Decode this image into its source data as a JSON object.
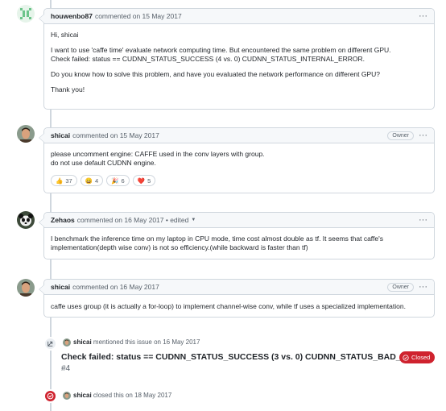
{
  "comments": [
    {
      "author": "houwenbo87",
      "meta": "commented on 15 May 2017",
      "paragraphs": [
        "Hi, shicai",
        "I want to use 'caffe time' evaluate network computing time. But encountered the same problem on different GPU.",
        "Check failed: status == CUDNN_STATUS_SUCCESS (4 vs. 0) CUDNN_STATUS_INTERNAL_ERROR.",
        "Do you know how to solve this problem, and have you evaluated the network performance on different GPU?",
        "Thank you!"
      ]
    },
    {
      "author": "shicai",
      "meta": "commented on 15 May 2017",
      "badge": "Owner",
      "paragraphs": [
        "please uncomment engine: CAFFE used in the conv layers with group.",
        "do not use default CUDNN engine."
      ],
      "reactions": [
        {
          "emoji": "👍",
          "count": "37"
        },
        {
          "emoji": "😄",
          "count": "4"
        },
        {
          "emoji": "🎉",
          "count": "6"
        },
        {
          "emoji": "❤️",
          "count": "5"
        }
      ]
    },
    {
      "author": "Zehaos",
      "meta": "commented on 16 May 2017 • edited",
      "paragraphs": [
        "I benchmark the inference time on my laptop in CPU mode, time cost almost double as tf. It seems that caffe's",
        "implementation(depth wise conv) is not so efficiency.(while backward is faster than tf)"
      ]
    },
    {
      "author": "shicai",
      "meta": "commented on 16 May 2017",
      "badge": "Owner",
      "paragraphs": [
        "caffe uses group (it is actually a for-loop) to implement channel-wise conv, while tf uses a specialized implementation."
      ]
    }
  ],
  "events": {
    "mention": {
      "author": "shicai",
      "text": "mentioned this issue on 16 May 2017",
      "ref_title": "Check failed: status == CUDNN_STATUS_SUCCESS (3 vs. 0) CUDNN_STATUS_BAD_PARAM",
      "ref_number": "#4",
      "ref_state": "Closed"
    },
    "closed": {
      "author": "shicai",
      "text": "closed this on 18 May 2017"
    }
  },
  "colors": {
    "closed_red": "#cf222e",
    "border": "#d0d7de",
    "header_bg": "#f6f8fa"
  },
  "icons": [
    "kebab-menu-icon",
    "cross-reference-icon",
    "issue-closed-icon",
    "dropdown-caret-icon"
  ]
}
